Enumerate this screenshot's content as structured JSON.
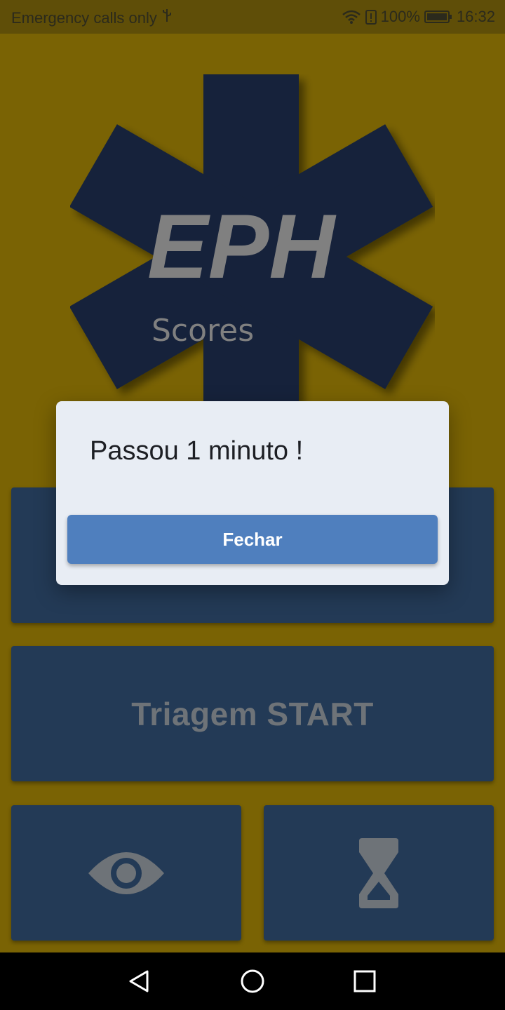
{
  "status_bar": {
    "carrier_text": "Emergency calls only",
    "battery": "100%",
    "time": "16:32",
    "icons": [
      "usb-icon",
      "wifi-icon",
      "alert-icon",
      "battery-icon"
    ]
  },
  "app": {
    "logo": {
      "title": "EPH",
      "subtitle": "Scores",
      "icon": "star-of-life-icon"
    },
    "cards": {
      "start_label": "Triagem START",
      "eye_icon": "eye-icon",
      "timer_icon": "hourglass-icon"
    }
  },
  "dialog": {
    "message": "Passou 1 minuto !",
    "button_label": "Fechar"
  },
  "nav_bar": {
    "icons": [
      "back-icon",
      "home-icon",
      "recents-icon"
    ]
  },
  "colors": {
    "background": "#7a6304",
    "card": "#233a56",
    "logo_star": "#17243a",
    "logo_text": "#808080",
    "dialog_bg": "#e8edf4",
    "button": "#4f7fbe"
  }
}
